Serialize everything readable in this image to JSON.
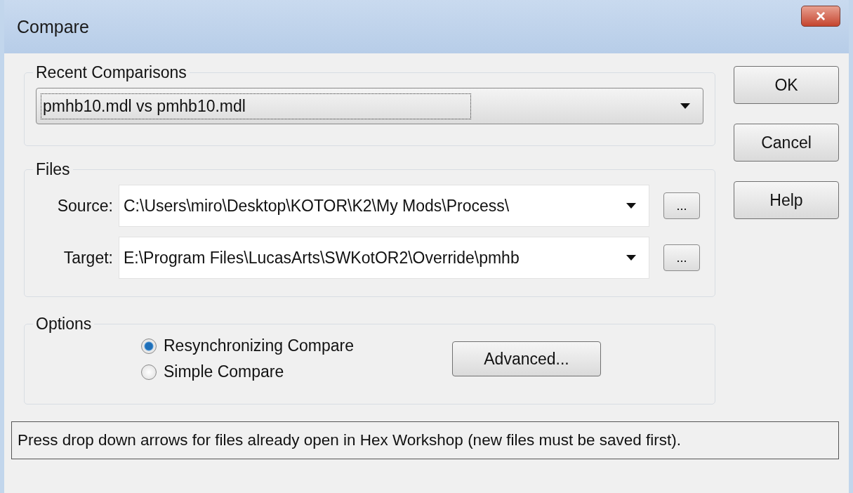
{
  "window": {
    "title": "Compare",
    "close": "×"
  },
  "recent": {
    "label": "Recent Comparisons",
    "value": "pmhb10.mdl vs pmhb10.mdl"
  },
  "files": {
    "label": "Files",
    "rows": [
      {
        "label": "Source:",
        "value": "C:\\Users\\miro\\Desktop\\KOTOR\\K2\\My Mods\\Process\\",
        "browse": "..."
      },
      {
        "label": "Target:",
        "value": "E:\\Program Files\\LucasArts\\SWKotOR2\\Override\\pmhb",
        "browse": "..."
      }
    ]
  },
  "options": {
    "label": "Options",
    "radios": [
      {
        "label": "Resynchronizing Compare",
        "selected": true
      },
      {
        "label": "Simple Compare",
        "selected": false
      }
    ],
    "advanced": "Advanced..."
  },
  "buttons": [
    "OK",
    "Cancel",
    "Help"
  ],
  "status_bar": "Press drop down arrows for files already open in Hex Workshop (new files must be saved first)."
}
